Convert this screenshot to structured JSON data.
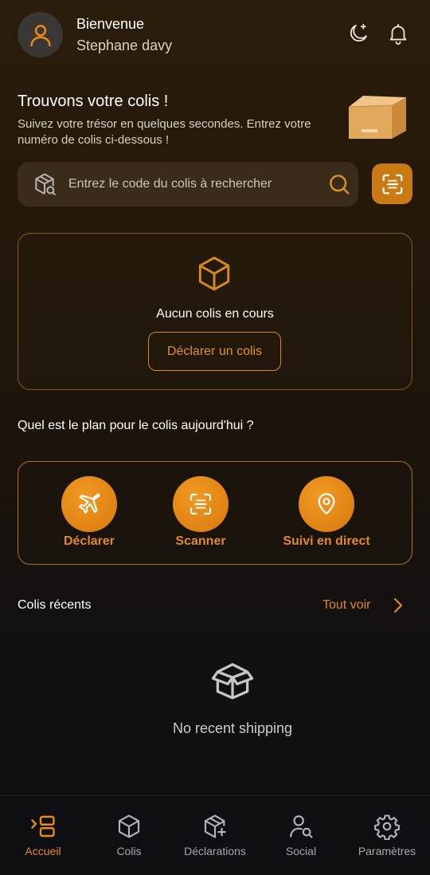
{
  "header": {
    "welcome": "Bienvenue",
    "username": "Stephane davy"
  },
  "hero": {
    "title": "Trouvons votre colis !",
    "subtitle": "Suivez votre trésor en quelques secondes. Entrez votre numéro de colis ci-dessous !"
  },
  "search": {
    "placeholder": "Entrez le code du colis à rechercher"
  },
  "current": {
    "empty_text": "Aucun colis en cours",
    "declare_label": "Déclarer un colis"
  },
  "plan": {
    "question": "Quel est le plan pour le colis aujourd'hui ?",
    "actions": [
      {
        "label": "Déclarer",
        "icon": "airplane-icon"
      },
      {
        "label": "Scanner",
        "icon": "scan-icon"
      },
      {
        "label": "Suivi en direct",
        "icon": "location-pin-icon"
      }
    ]
  },
  "recent": {
    "title": "Colis récents",
    "see_all": "Tout voir",
    "empty_text": "No recent shipping"
  },
  "nav": {
    "items": [
      {
        "label": "Accueil",
        "icon": "home-icon",
        "active": true
      },
      {
        "label": "Colis",
        "icon": "box-icon",
        "active": false
      },
      {
        "label": "Déclarations",
        "icon": "box-add-icon",
        "active": false
      },
      {
        "label": "Social",
        "icon": "user-search-icon",
        "active": false
      },
      {
        "label": "Paramètres",
        "icon": "gear-icon",
        "active": false
      }
    ]
  },
  "colors": {
    "accent": "#e88a1a",
    "accent_dark": "#c97a12",
    "background_top": "#2b1d0b",
    "background_bottom": "#0e0d12"
  }
}
